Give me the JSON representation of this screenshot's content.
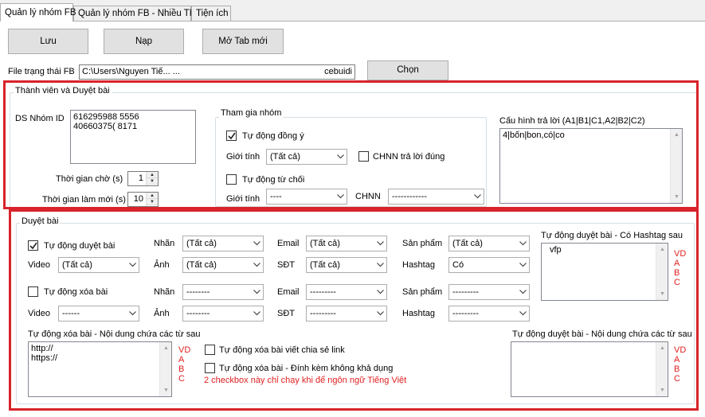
{
  "tabs": [
    {
      "label": "Quản lý nhóm FB",
      "active": true
    },
    {
      "label": "Quản lý nhóm FB - Nhiều TK",
      "active": false
    },
    {
      "label": "Tiện ích",
      "active": false
    }
  ],
  "toolbar": {
    "save_label": "Lưu",
    "load_label": "Nạp",
    "new_tab_label": "Mở Tab mới"
  },
  "state_file": {
    "label": "File trạng thái FB",
    "value": "C:\\Users\\Nguyen Tiế... ...",
    "value_tail": "cebuidi",
    "choose_label": "Chọn"
  },
  "members": {
    "title": "Thành viên và Duyệt bài",
    "group_ids_label": "DS Nhóm ID",
    "group_ids": [
      "616295988 5556",
      "40660375( 8171"
    ],
    "wait_time_label": "Thời gian chờ (s)",
    "wait_time_value": "1",
    "refresh_time_label": "Thời gian làm mới (s)",
    "refresh_time_value": "10",
    "join": {
      "title": "Tham gia nhóm",
      "auto_accept_label": "Tự động đồng ý",
      "auto_accept_checked": true,
      "gender_label": "Giới tính",
      "gender_value": "(Tất cả)",
      "chnn_correct_label": "CHNN trả lời đúng",
      "chnn_correct_checked": false,
      "auto_reject_label": "Tự động từ chối",
      "auto_reject_checked": false,
      "gender2_label": "Giới tính",
      "gender2_value": "----",
      "chnn_label": "CHNN",
      "chnn_value": "------------"
    },
    "reply_config": {
      "label": "Cấu hình trả lời (A1|B1|C1,A2|B2|C2)",
      "value": "4|bốn|bon,có|co"
    }
  },
  "posts": {
    "title": "Duyệt bài",
    "auto_approve_label": "Tự động duyệt bài",
    "auto_approve_checked": true,
    "auto_delete_label": "Tự động xóa bài",
    "auto_delete_checked": false,
    "row1": [
      {
        "label": "Nhãn",
        "value": "(Tất cả)"
      },
      {
        "label": "Email",
        "value": "(Tất cả)"
      },
      {
        "label": "Sản phẩm",
        "value": "(Tất cả)"
      }
    ],
    "row2": [
      {
        "label": "Video",
        "value": "(Tất cả)"
      },
      {
        "label": "Ảnh",
        "value": "(Tất cả)"
      },
      {
        "label": "SĐT",
        "value": "(Tất cả)"
      },
      {
        "label": "Hashtag",
        "value": "Có"
      }
    ],
    "row3": [
      {
        "label": "Nhãn",
        "value": "--------"
      },
      {
        "label": "Email",
        "value": "---------"
      },
      {
        "label": "Sản phẩm",
        "value": "---------"
      }
    ],
    "row4": [
      {
        "label": "Video",
        "value": "------"
      },
      {
        "label": "Ảnh",
        "value": "--------"
      },
      {
        "label": "SĐT",
        "value": "---------"
      },
      {
        "label": "Hashtag",
        "value": "---------"
      }
    ],
    "hashtag_box": {
      "label": "Tự động duyệt bài - Có Hashtag sau",
      "value": "vfp",
      "note": [
        "VD",
        "A",
        "B",
        "C"
      ]
    },
    "delete_keywords": {
      "label": "Tự động xóa bài - Nội dung chứa các từ sau",
      "lines": [
        "http://",
        "https://"
      ],
      "note": [
        "VD",
        "A",
        "B",
        "C"
      ]
    },
    "delete_shared_link_label": "Tự động xóa bài viết chia sẻ link",
    "delete_shared_link_checked": false,
    "delete_unavailable_label": "Tự động xóa bài - Đính kèm không khả dụng",
    "delete_unavailable_checked": false,
    "vietnamese_note": "2 checkbox này chỉ chạy khi để ngôn ngữ Tiếng Việt",
    "approve_keywords": {
      "label": "Tự động duyệt bài - Nội dung chứa các từ sau",
      "value": "",
      "note": [
        "VD",
        "A",
        "B",
        "C"
      ]
    }
  },
  "colors": {
    "highlight_frame": "#d8232a",
    "note_red": "#e02020"
  }
}
